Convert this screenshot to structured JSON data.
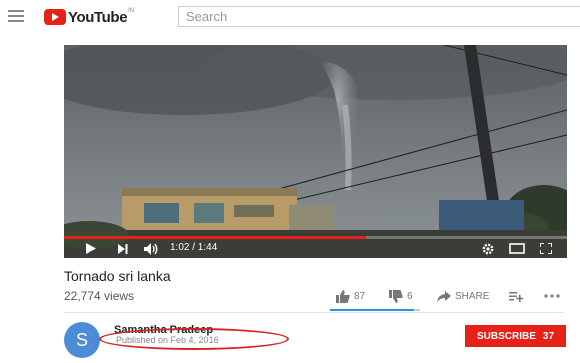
{
  "header": {
    "logo_text": "YouTube",
    "logo_country": "IN",
    "search_placeholder": "Search"
  },
  "player": {
    "current_time": "1:02",
    "duration": "1:44",
    "time_display": "1:02 / 1:44",
    "progress_fraction": 0.6
  },
  "video": {
    "title": "Tornado sri lanka",
    "views": "22,774 views",
    "likes": "87",
    "dislikes": "6",
    "share_label": "SHARE",
    "like_ratio": 0.935
  },
  "channel": {
    "avatar_letter": "S",
    "name": "Samantha Pradeep",
    "published": "Published on Feb 4, 2016",
    "subscribe_label": "SUBSCRIBE",
    "subscriber_count": "37"
  },
  "colors": {
    "brand_red": "#e62117",
    "avatar_blue": "#4c8bd6",
    "like_blue": "#2793e6",
    "annotation_red": "#d42424"
  }
}
